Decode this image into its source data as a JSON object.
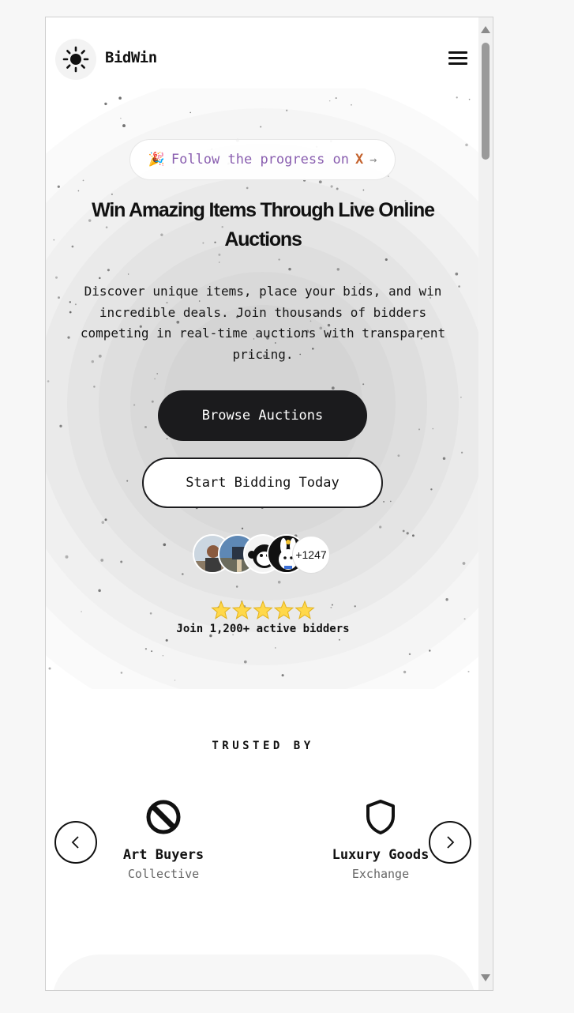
{
  "header": {
    "brand": "BidWin",
    "logo_icon": "sun-icon",
    "menu_icon": "hamburger-menu-icon"
  },
  "hero": {
    "announcement": {
      "emoji": "🎉",
      "text": "Follow the progress on",
      "highlight": "X",
      "arrow": "→"
    },
    "headline": "Win Amazing Items Through Live Online Auctions",
    "subtext": "Discover unique items, place your bids, and win incredible deals. Join thousands of bidders competing in real-time auctions with transparent pricing.",
    "primary_cta": "Browse Auctions",
    "secondary_cta": "Start Bidding Today",
    "avatar_count": "+1247",
    "rating_stars": 5,
    "social_proof": "Join 1,200+ active bidders"
  },
  "trusted": {
    "heading": "TRUSTED BY",
    "items": [
      {
        "name": "Art Buyers",
        "sub": "Collective",
        "icon": "prohibited-circle-icon"
      },
      {
        "name": "Luxury Goods",
        "sub": "Exchange",
        "icon": "shield-icon"
      }
    ],
    "prev_icon": "chevron-left-icon",
    "next_icon": "chevron-right-icon"
  },
  "colors": {
    "primary_button": "#1b1b1d",
    "follow_text": "#8a5fb0",
    "follow_x": "#c4622d",
    "star": "#ffd84a"
  }
}
